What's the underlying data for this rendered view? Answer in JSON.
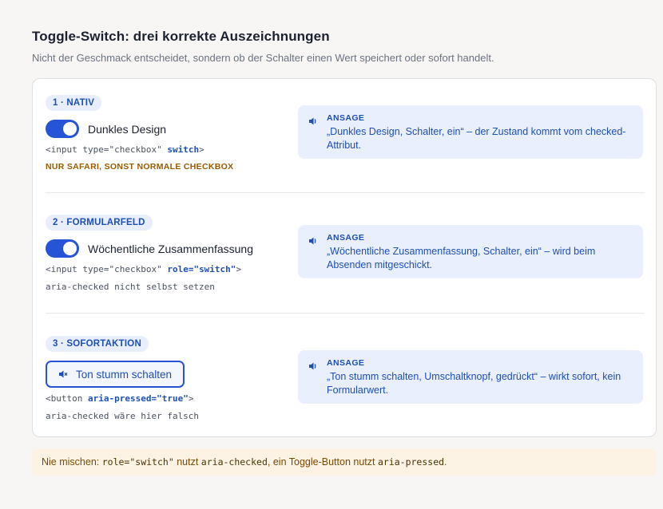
{
  "header": {
    "title": "Toggle-Switch: drei korrekte Auszeichnungen",
    "subtitle": "Nicht der Geschmack entscheidet, sondern ob der Schalter einen Wert speichert oder sofort handelt."
  },
  "sections": [
    {
      "badge": "1 · NATIV",
      "control_label": "Dunkles Design",
      "control_state": "on",
      "code_prefix": "<input type=\"checkbox\" ",
      "code_keyword": "switch",
      "code_suffix": ">",
      "note": "NUR SAFARI, SONST NORMALE CHECKBOX",
      "announce_heading": "ANSAGE",
      "announce_text": "„Dunkles Design, Schalter, ein“ – der Zustand kommt vom checked-Attribut."
    },
    {
      "badge": "2 · FORMULARFELD",
      "control_label": "Wöchentliche Zusammenfassung",
      "control_state": "on",
      "code_prefix": "<input type=\"checkbox\" ",
      "code_keyword": "role=\"switch\"",
      "code_suffix": ">",
      "note": "aria-checked nicht selbst setzen",
      "announce_heading": "ANSAGE",
      "announce_text": "„Wöchentliche Zusammenfassung, Schalter, ein“ – wird beim Absenden mitgeschickt."
    },
    {
      "badge": "3 · SOFORTAKTION",
      "control_label": "Ton stumm schalten",
      "control_icon": "speaker-mute-icon",
      "code_prefix": "<button ",
      "code_keyword": "aria-pressed=\"true\"",
      "code_suffix": ">",
      "note": "aria-checked wäre hier falsch",
      "announce_heading": "ANSAGE",
      "announce_text": "„Ton stumm schalten, Umschaltknopf, gedrückt“ – wirkt sofort, kein Formularwert."
    }
  ],
  "footer_note": {
    "part1": "Nie mischen: ",
    "code1": "role=\"switch\"",
    "part2": " nutzt ",
    "code2": "aria-checked",
    "part3": ", ein Toggle-Button nutzt ",
    "code3": "aria-pressed",
    "part4": "."
  },
  "colors": {
    "accent": "#2554d6",
    "announce_bg": "#e9effc",
    "warning_text": "#9a5a00",
    "note_bg": "#fdf3e5"
  }
}
